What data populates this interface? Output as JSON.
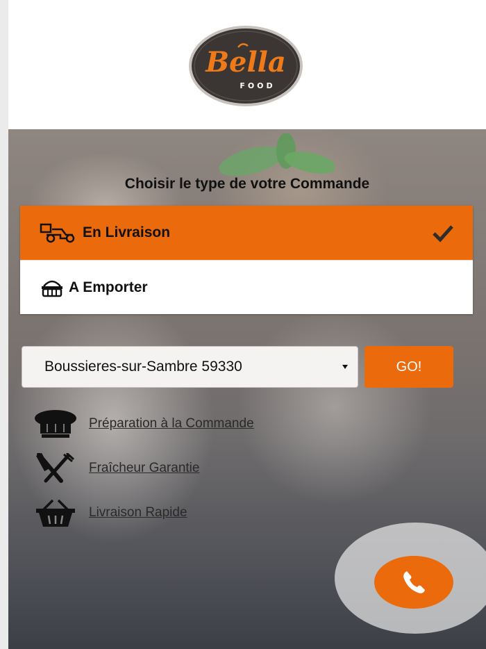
{
  "brand": {
    "logo_text": "Bella",
    "logo_subtext": "FOOD",
    "accent_color": "#ea6a0c"
  },
  "order": {
    "heading": "Choisir le type de votre Commande",
    "options": [
      {
        "label": "En Livraison",
        "icon": "delivery-scooter-icon",
        "selected": true
      },
      {
        "label": "A Emporter",
        "icon": "takeaway-basket-icon",
        "selected": false
      }
    ]
  },
  "location": {
    "selected_value": "Boussieres-sur-Sambre 59330",
    "go_label": "GO!"
  },
  "features": [
    {
      "label": "Préparation à la Commande",
      "icon": "chef-hat-icon"
    },
    {
      "label": "Fraîcheur Garantie",
      "icon": "knife-fork-icon"
    },
    {
      "label": "Livraison Rapide",
      "icon": "shopping-basket-icon"
    }
  ],
  "call": {
    "icon": "phone-icon"
  }
}
